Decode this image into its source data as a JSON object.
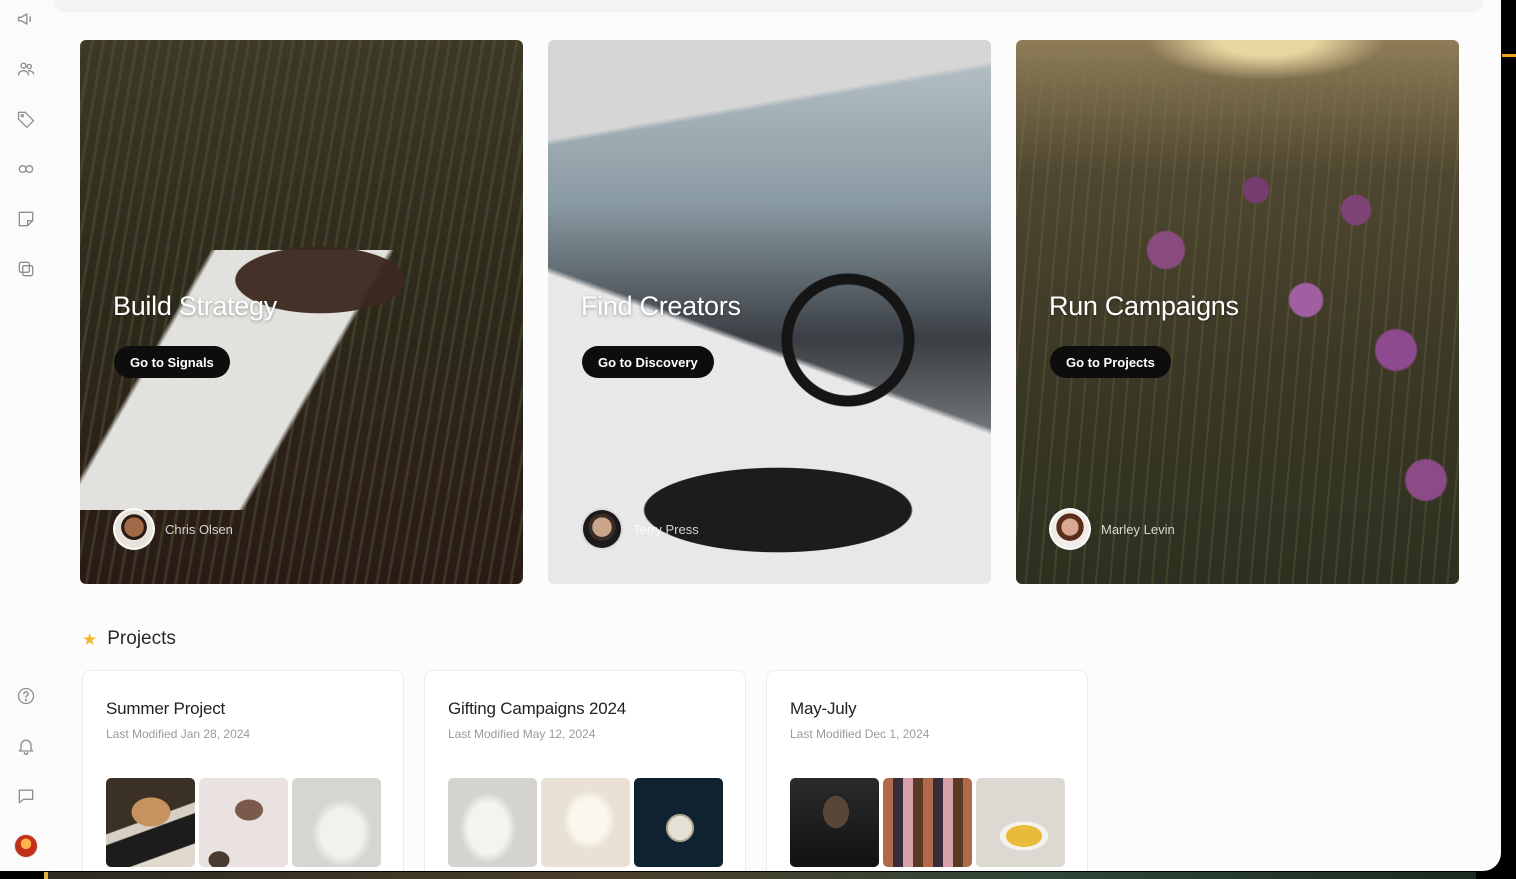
{
  "sidebar": {
    "top_icons": [
      "megaphone-icon",
      "users-icon",
      "tag-icon",
      "link-icon",
      "note-icon",
      "gallery-icon"
    ],
    "bottom_icons": [
      "help-icon",
      "bell-icon",
      "chat-icon"
    ]
  },
  "hero_cards": [
    {
      "title": "Build Strategy",
      "button": "Go to Signals",
      "creator": "Chris Olsen"
    },
    {
      "title": "Find Creators",
      "button": "Go to Discovery",
      "creator": "Terry Press"
    },
    {
      "title": "Run Campaigns",
      "button": "Go to Projects",
      "creator": "Marley Levin"
    }
  ],
  "projects": {
    "title": "Projects",
    "items": [
      {
        "name": "Summer Project",
        "modified": "Last Modified Jan 28, 2024"
      },
      {
        "name": "Gifting Campaigns 2024",
        "modified": "Last Modified May 12, 2024"
      },
      {
        "name": "May-July",
        "modified": "Last Modified Dec 1, 2024"
      }
    ]
  },
  "colors": {
    "accent_star": "#f2b632",
    "button_bg": "#0d0d0d",
    "page_bg": "#fcfcfc"
  }
}
